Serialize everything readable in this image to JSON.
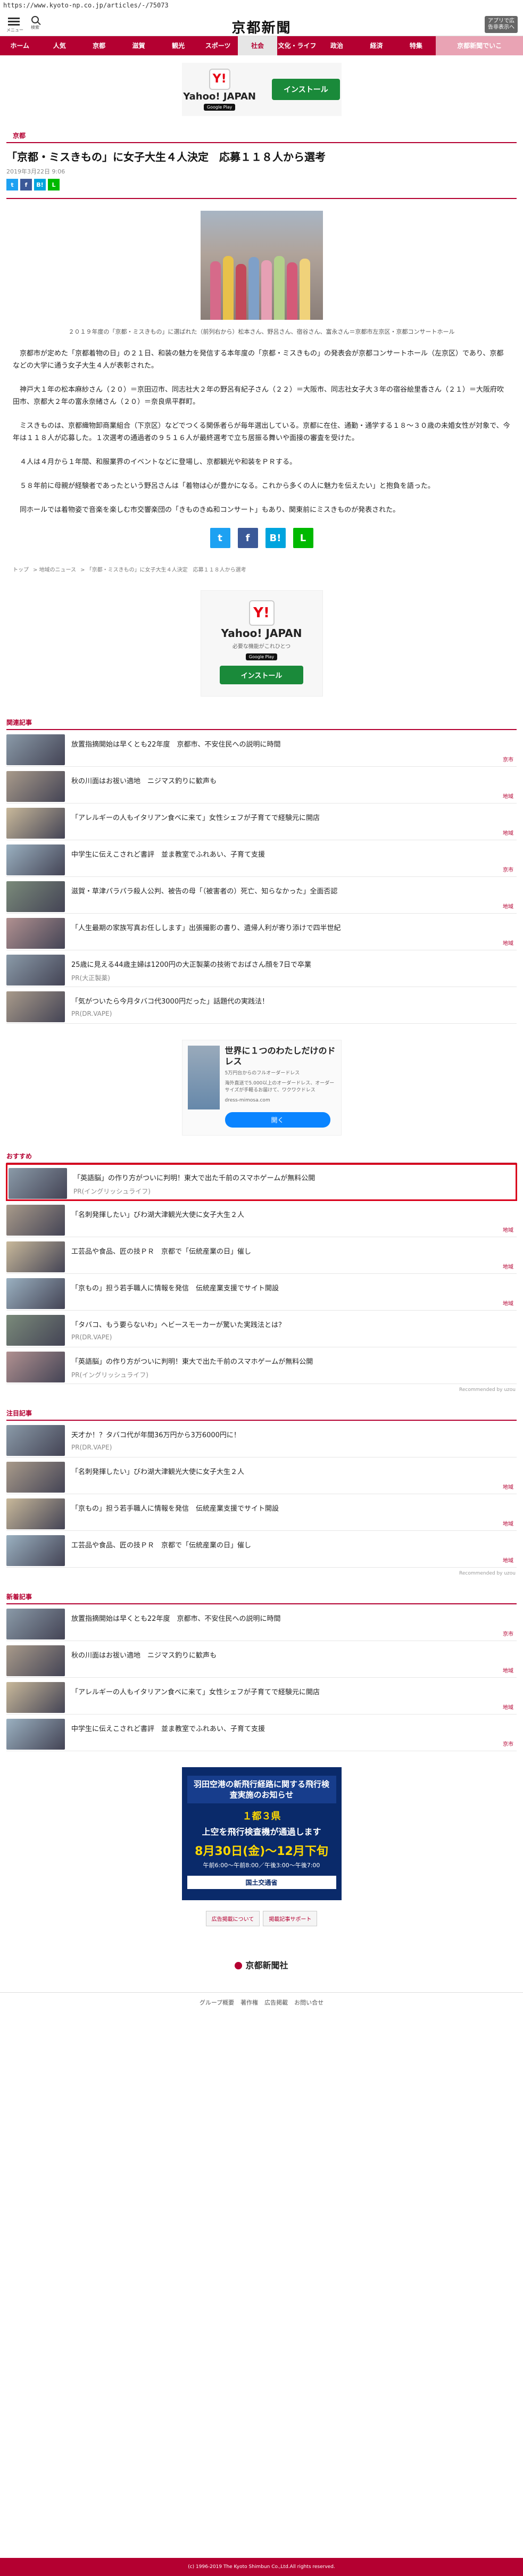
{
  "url": "https://www.kyoto-np.co.jp/articles/-/75073",
  "header": {
    "menu_label": "メニュー",
    "search_label": "検索",
    "logo": "京都新聞",
    "adfree": "アプリで広告非表示へ"
  },
  "nav": [
    "ホーム",
    "人気",
    "京都",
    "滋賀",
    "観光",
    "スポーツ",
    "社会",
    "文化・ライフ",
    "政治",
    "経済",
    "特集",
    "京都新聞でいこ"
  ],
  "top_ad": {
    "brand": "Yahoo! JAPAN",
    "store": "Google Play",
    "cta": "インストール"
  },
  "article": {
    "kicker": "京都",
    "title": "「京都・ミスきもの」に女子大生４人決定　応募１１８人から選考",
    "date": "2019年3月22日 9:06",
    "caption": "２０１９年度の「京都・ミスきもの」に選ばれた（前列右から）松本さん、野呂さん、宿谷さん、富永さん＝京都市左京区・京都コンサートホール",
    "paragraphs": [
      "京都市が定めた「京都着物の日」の２１日、和装の魅力を発信する本年度の「京都・ミスきもの」の発表会が京都コンサートホール（左京区）であり、京都などの大学に通う女子大生４人が表彰された。",
      "神戸大１年の松本麻紗さん（２０）＝京田辺市、同志社大２年の野呂有紀子さん（２２）＝大阪市、同志社女子大３年の宿谷絵里香さん（２１）＝大阪府吹田市、京都大２年の富永奈緒さん（２０）＝奈良県平群町。",
      "ミスきものは、京都織物卸商業組合（下京区）などでつくる関係者らが毎年選出している。京都に在住、通勤・通学する１８～３０歳の未婚女性が対象で、今年は１１８人が応募した。１次選考の通過者の９５１６人が最終選考で立ち居振る舞いや面接の審査を受けた。",
      "４人は４月から１年間、和服業界のイベントなどに登場し、京都観光や和装をＰＲする。",
      "５８年前に母親が経験者であったという野呂さんは「着物は心が豊かになる。これから多くの人に魅力を伝えたい」と抱負を語った。",
      "同ホールでは着物姿で音楽を楽しむ市交響楽団の「きものきぬ和コンサート」もあり、関東前にミスきものが発表された。"
    ],
    "breadcrumb": [
      "トップ",
      "地域のニュース",
      "「京都・ミスきもの」に女子大生４人決定　応募１１８人から選考"
    ]
  },
  "mid_ad": {
    "brand": "Yahoo! JAPAN",
    "sub": "必要な機能がこれひとつ",
    "store": "Google Play",
    "cta": "インストール"
  },
  "related": {
    "heading": "関連記事",
    "items": [
      {
        "title": "放置指摘開始は早くとも22年度　京都市、不安住民への説明に時間",
        "tag": "京市"
      },
      {
        "title": "秋の川面はお祓い適地　ニジマス釣りに歓声も",
        "tag": "地域"
      },
      {
        "title": "「アレルギーの人もイタリアン食べに来て」女性シェフが子育てで経験元に開店",
        "tag": "地域"
      },
      {
        "title": "中学生に伝えこされど書評　並ま教室でふれあい、子育て支援",
        "tag": "京市"
      },
      {
        "title": "滋賀・草津パラパラ殺人公判、被告の母「（被害者の）死亡、知らなかった」全面否認",
        "tag": "地域"
      },
      {
        "title": "「人生最期の家族写真お任しします」出張撮影の書り、遺帰人利が寄り添けで四半世紀",
        "tag": "地域"
      }
    ],
    "pr_items": [
      {
        "title": "25歳に見える44歳主婦は1200円の大正製薬の技術でおばさん顔を7日で卒業",
        "pr": "PR(大正製薬)"
      },
      {
        "title": "「気がついたら今月タバコ代3000円だった」話題代の実践法！",
        "pr": "PR(DR.VAPE)"
      }
    ]
  },
  "display_ad": {
    "title": "世界に１つのわたしだけのドレス",
    "sub": "5万円台からのフルオーダードレス",
    "desc": "海外直送で5.000以上のオーダードレス、オーダーサイズが手軽るお届けて、ワクワクドレス",
    "domain": "dress-mimosa.com",
    "cta": "開く"
  },
  "recommend": {
    "heading": "おすすめ",
    "items": [
      {
        "title": "「英語脳」の作り方がついに判明！東大で出た千前のスマホゲームが無料公開",
        "sub": "PR(イングリッシュライフ)",
        "highlight": true
      },
      {
        "title": "「名刺発揮したい」びわ湖大津観光大使に女子大生２人",
        "sub": "地域"
      },
      {
        "title": "工芸品や食品、匠の技ＰＲ　京都で「伝統産業の日」催し",
        "sub": "地域"
      },
      {
        "title": "「京もの」担う若手職人に情報を発信　伝統産業支援でサイト開設",
        "sub": "地域"
      },
      {
        "title": "「タバコ、もう要らないわ」ヘビースモーカーが驚いた実践法とは？",
        "sub": "PR(DR.VAPE)"
      },
      {
        "title": "「英語脳」の作り方がついに判明！東大で出た千前のスマホゲームが無料公開",
        "sub": "PR(イングリッシュライフ)"
      }
    ],
    "powered": "Recommended by uzou"
  },
  "popular": {
    "heading": "注目記事",
    "items": [
      {
        "title": "天才か！？タバコ代が年間36万円から3万6000円に！",
        "sub": "PR(DR.VAPE)"
      },
      {
        "title": "「名刺発揮したい」びわ湖大津観光大使に女子大生２人",
        "sub": "地域"
      },
      {
        "title": "「京もの」担う若手職人に情報を発信　伝統産業支援でサイト開設",
        "sub": "地域"
      },
      {
        "title": "工芸品や食品、匠の技ＰＲ　京都で「伝統産業の日」催し",
        "sub": "地域"
      }
    ],
    "powered": "Recommended by uzou"
  },
  "latest": {
    "heading": "新着記事",
    "items": [
      {
        "title": "放置指摘開始は早くとも22年度　京都市、不安住民への説明に時間",
        "tag": "京市"
      },
      {
        "title": "秋の川面はお祓い適地　ニジマス釣りに歓声も",
        "tag": "地域"
      },
      {
        "title": "「アレルギーの人もイタリアン食べに来て」女性シェフが子育てで経験元に開店",
        "tag": "地域"
      },
      {
        "title": "中学生に伝えこされど書評　並ま教室でふれあい、子育て支援",
        "tag": "京市"
      }
    ]
  },
  "bottom_ad": {
    "l1": "羽田空港の新飛行経路に関する飛行検査実施のお知らせ",
    "l2": "１都３県",
    "l3": "上空を飛行検査機が通過します",
    "l4": "8月30日(金)～12月下旬",
    "l5": "午前6:00～午前8:00／午後3:00～午後7:00",
    "l6": "国土交通省",
    "links": [
      "広告掲載について",
      "掲載記事サポート"
    ]
  },
  "footer": {
    "logo": "京都新聞社",
    "links": [
      "グループ概要",
      "著作権",
      "広告掲載",
      "お問い合せ"
    ],
    "copy": "(c) 1996-2019 The Kyoto Shimbun Co.,Ltd.All rights reserved."
  }
}
